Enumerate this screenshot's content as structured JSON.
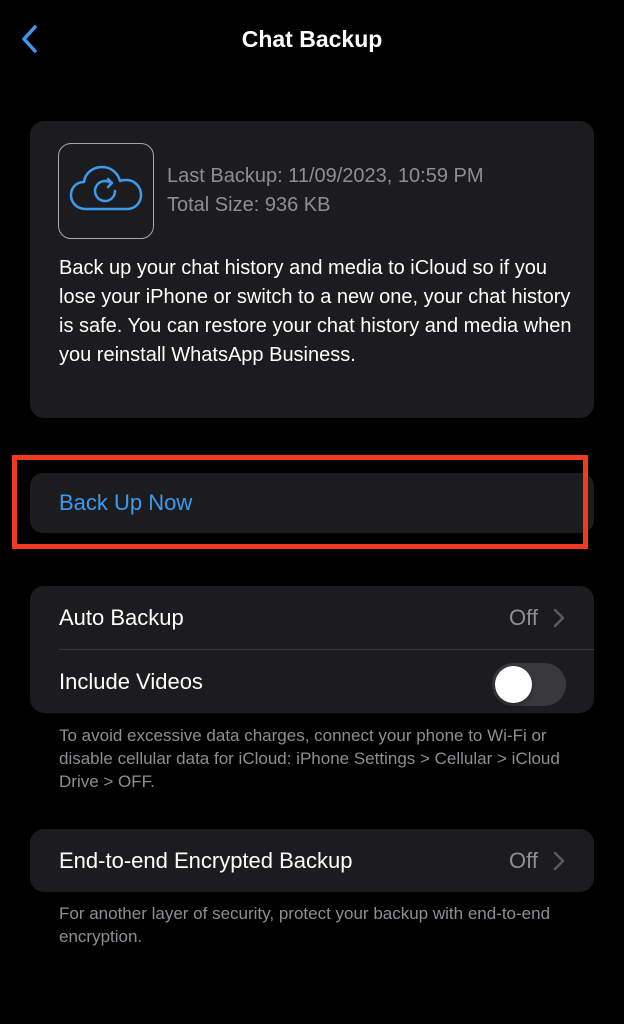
{
  "nav": {
    "title": "Chat Backup",
    "back_icon": "chevron-left-icon"
  },
  "colors": {
    "background": "#000000",
    "card": "#1c1c1e",
    "accent": "#3a9bf0",
    "secondary_text": "#8e8e93",
    "highlight_border": "#ee3a1f"
  },
  "backup_info": {
    "icon": "icloud-backup-icon",
    "last_backup": "Last Backup: 11/09/2023, 10:59 PM",
    "total_size": "Total Size: 936 KB",
    "description": "Back up your chat history and media to iCloud so if you lose your iPhone or switch to a new one, your chat history is safe. You can restore your chat history and media when you reinstall WhatsApp Business."
  },
  "backup_now": {
    "label": "Back Up Now"
  },
  "settings": {
    "auto_backup": {
      "label": "Auto Backup",
      "value": "Off"
    },
    "include_videos": {
      "label": "Include Videos",
      "enabled": false
    },
    "footnote": "To avoid excessive data charges, connect your phone to Wi-Fi or disable cellular data for iCloud: iPhone Settings > Cellular > iCloud Drive > OFF."
  },
  "e2e_backup": {
    "label": "End-to-end Encrypted Backup",
    "value": "Off",
    "footnote": "For another layer of security, protect your backup with end-to-end encryption."
  }
}
